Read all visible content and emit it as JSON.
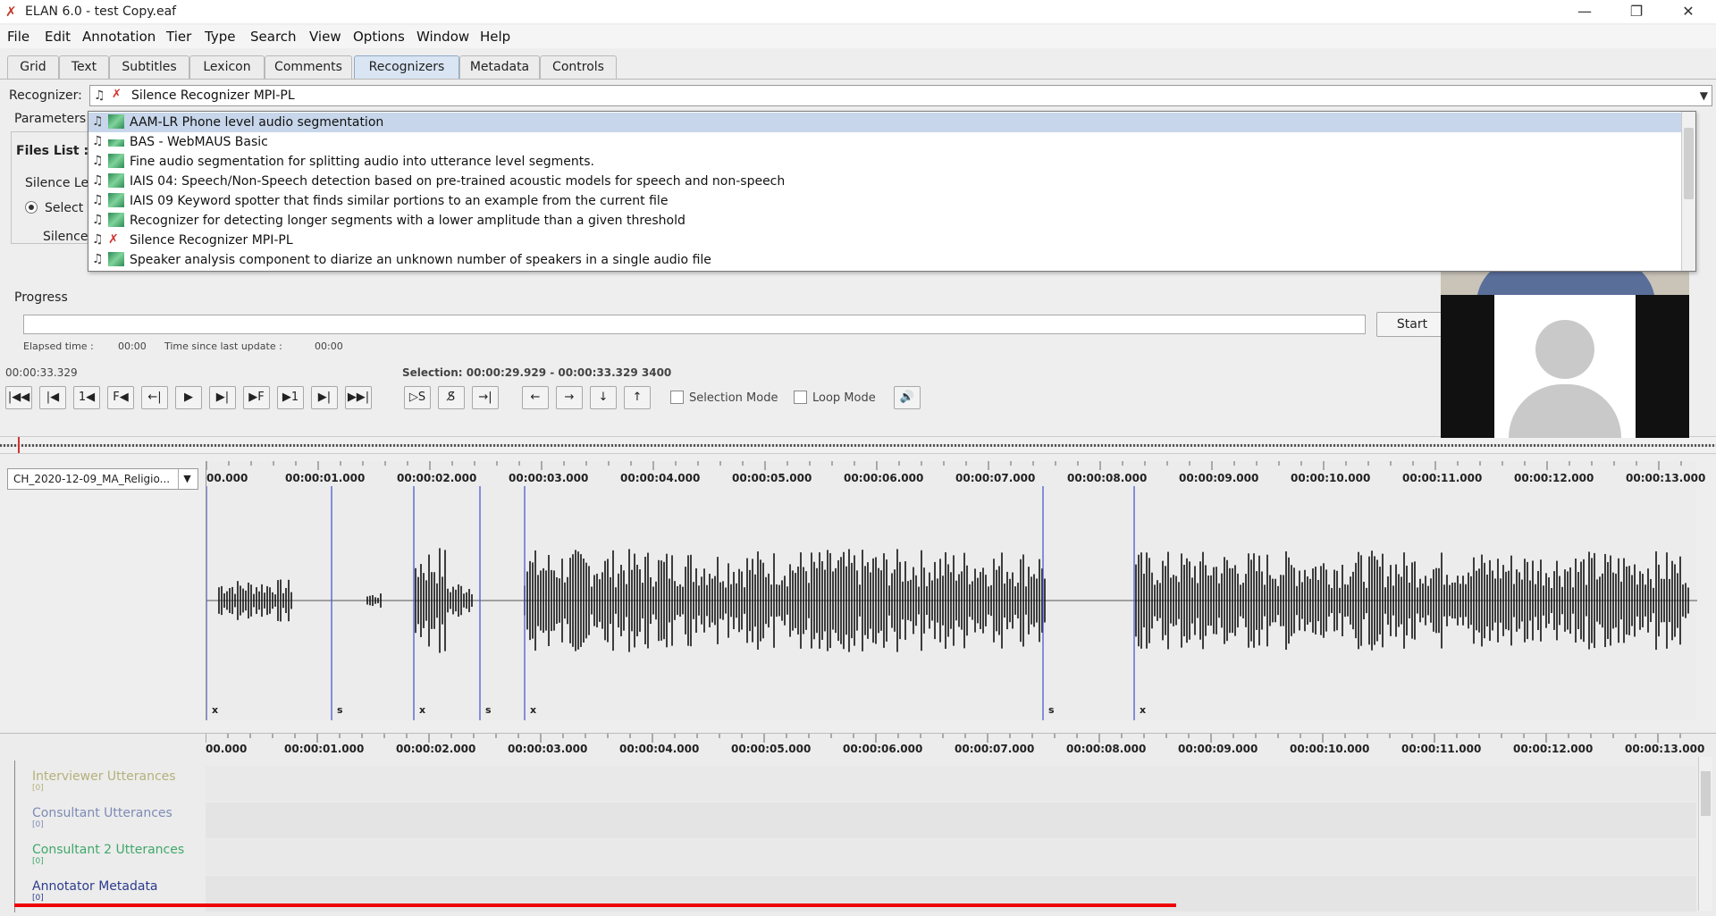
{
  "window": {
    "title": "ELAN 6.0 - test Copy.eaf",
    "minimize": "—",
    "restore": "❐",
    "close": "✕"
  },
  "menu": [
    "File",
    "Edit",
    "Annotation",
    "Tier",
    "Type",
    "Search",
    "View",
    "Options",
    "Window",
    "Help"
  ],
  "tabs": [
    "Grid",
    "Text",
    "Subtitles",
    "Lexicon",
    "Comments",
    "Recognizers",
    "Metadata",
    "Controls"
  ],
  "active_tab": "Recognizers",
  "recognizer": {
    "label": "Recognizer:",
    "selected": "Silence Recognizer MPI-PL",
    "parameters_label": "Parameters",
    "files_list_label": "Files List :",
    "silence_level_label": "Silence Le",
    "select_label": "Select",
    "silence_label": "Silence"
  },
  "dropdown_items": [
    {
      "label": "AAM-LR Phone level audio segmentation",
      "icon": "green",
      "selected": true
    },
    {
      "label": "BAS - WebMAUS Basic",
      "icon": "green-small",
      "selected": false
    },
    {
      "label": "Fine audio segmentation for splitting audio into utterance level segments.",
      "icon": "green",
      "selected": false
    },
    {
      "label": "IAIS 04: Speech/Non-Speech detection based on pre-trained acoustic models for speech and non-speech",
      "icon": "green",
      "selected": false
    },
    {
      "label": "IAIS 09 Keyword spotter that finds similar portions to an example from the current file",
      "icon": "green",
      "selected": false
    },
    {
      "label": "Recognizer for detecting longer segments with a lower amplitude than a given threshold",
      "icon": "green",
      "selected": false
    },
    {
      "label": "Silence Recognizer MPI-PL",
      "icon": "red",
      "selected": false
    },
    {
      "label": "Speaker analysis component to diarize an unknown number of speakers in a single audio file",
      "icon": "green",
      "selected": false
    }
  ],
  "progress": {
    "label": "Progress",
    "start": "Start",
    "elapsed_label": "Elapsed time :",
    "elapsed_value": "00:00",
    "since_label": "Time since last update :",
    "since_value": "00:00"
  },
  "media": {
    "current_time": "00:00:33.329",
    "selection": "Selection: 00:00:29.929 - 00:00:33.329  3400",
    "selection_mode": "Selection Mode",
    "loop_mode": "Loop Mode",
    "buttons": [
      "|◀◀",
      "|◀",
      "1◀",
      "F◀",
      "←|",
      "▶",
      "▶|",
      "▶F",
      "▶1",
      "▶|",
      "▶▶|"
    ],
    "sel_buttons": [
      "▷S",
      "S̸",
      "→|"
    ],
    "nav_buttons": [
      "←",
      "→",
      "↓",
      "↑"
    ],
    "volume_icon": "🔊"
  },
  "waveform": {
    "tier": "CH_2020-12-09_MA_Religio...",
    "ticks": [
      "00.000",
      "00:00:01.000",
      "00:00:02.000",
      "00:00:03.000",
      "00:00:04.000",
      "00:00:05.000",
      "00:00:06.000",
      "00:00:07.000",
      "00:00:08.000",
      "00:00:09.000",
      "00:00:10.000",
      "00:00:11.000",
      "00:00:12.000",
      "00:00:13.000"
    ],
    "segment_marks": [
      "x",
      "s",
      "x",
      "s",
      "x",
      "s",
      "x"
    ]
  },
  "tiers": [
    {
      "name": "Interviewer Utterances",
      "color": "#b5b07a",
      "sub": "[0]"
    },
    {
      "name": "Consultant Utterances",
      "color": "#7d8ab5",
      "sub": "[0]"
    },
    {
      "name": "Consultant 2 Utterances",
      "color": "#3fa86a",
      "sub": "[0]"
    },
    {
      "name": "Annotator Metadata",
      "color": "#2d3b8c",
      "sub": "[0]"
    }
  ],
  "colors": {
    "accent": "#d0312d",
    "selection": "#c7d6ea",
    "boundary": "#4a5bd0"
  }
}
